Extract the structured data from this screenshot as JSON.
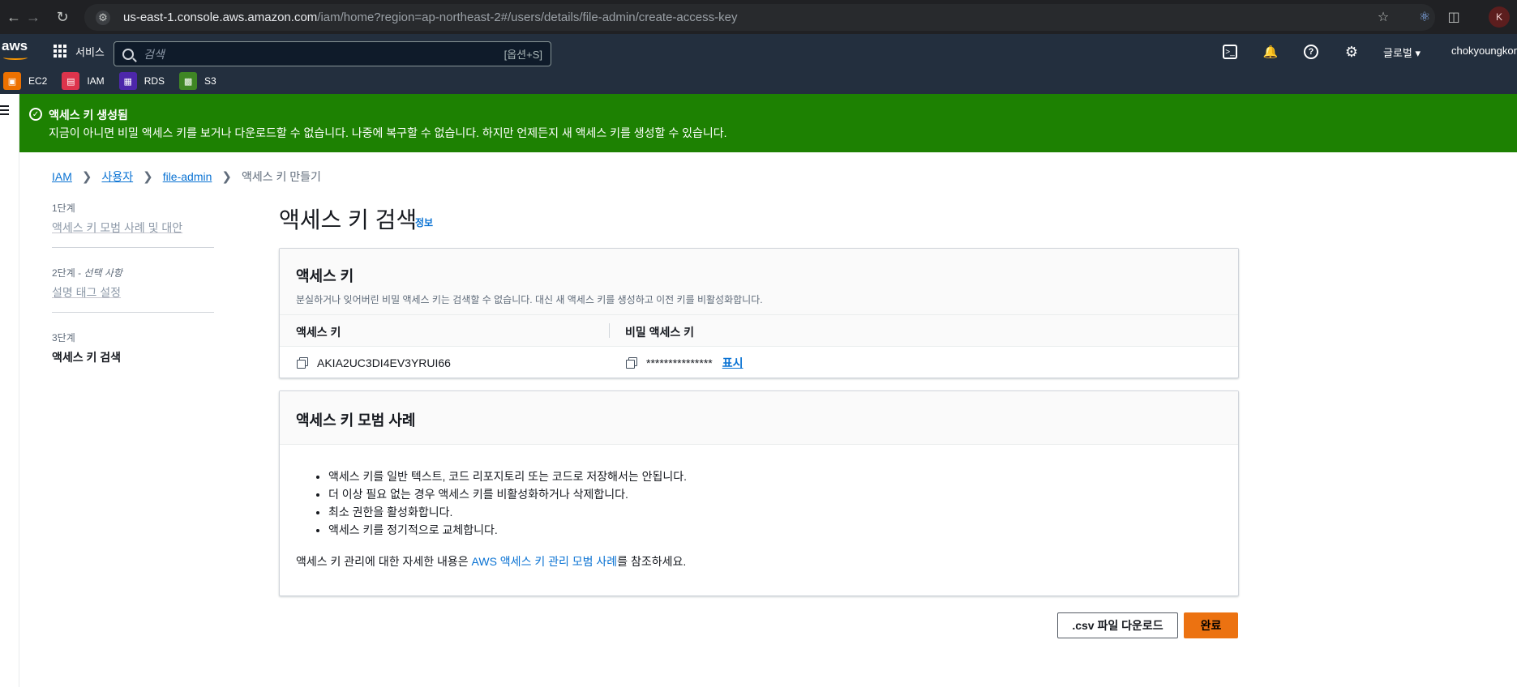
{
  "browser": {
    "url_host": "us-east-1.console.aws.amazon.com",
    "url_path": "/iam/home?region=ap-northeast-2#/users/details/file-admin/create-access-key",
    "profile_initial": "K"
  },
  "topnav": {
    "logo": "aws",
    "services_label": "서비스",
    "search_placeholder": "검색",
    "search_hint": "[옵션+S]",
    "region_label": "글로벌 ▾",
    "user_label": "chokyoungkon"
  },
  "favorites": [
    {
      "label": "EC2",
      "color": "#ed7100"
    },
    {
      "label": "IAM",
      "color": "#dd344c"
    },
    {
      "label": "RDS",
      "color": "#4d27aa"
    },
    {
      "label": "S3",
      "color": "#3f8624"
    }
  ],
  "flash": {
    "title": "액세스 키 생성됨",
    "message": "지금이 아니면 비밀 액세스 키를 보거나 다운로드할 수 없습니다. 나중에 복구할 수 없습니다. 하지만 언제든지 새 액세스 키를 생성할 수 있습니다.",
    "color": "#1d8102"
  },
  "breadcrumb": {
    "items": [
      "IAM",
      "사용자",
      "file-admin"
    ],
    "current": "액세스 키 만들기"
  },
  "steps": [
    {
      "label": "1단계",
      "label_suffix": "",
      "name": "액세스 키 모범 사례 및 대안"
    },
    {
      "label": "2단계 - ",
      "label_suffix": "선택 사항",
      "name": "설명 태그 설정"
    },
    {
      "label": "3단계",
      "label_suffix": "",
      "name": "액세스 키 검색"
    }
  ],
  "page": {
    "title": "액세스 키 검색",
    "info_link": "정보"
  },
  "access_key_panel": {
    "title": "액세스 키",
    "description": "분실하거나 잊어버린 비밀 액세스 키는 검색할 수 없습니다. 대신 새 액세스 키를 생성하고 이전 키를 비활성화합니다.",
    "col_access_key": "액세스 키",
    "col_secret_key": "비밀 액세스 키",
    "access_key_value": "AKIA2UC3DI4EV3YRUI66",
    "secret_key_masked": "***************",
    "show_label": "표시"
  },
  "best_practices_panel": {
    "title": "액세스 키 모범 사례",
    "items": [
      "액세스 키를 일반 텍스트, 코드 리포지토리 또는 코드로 저장해서는 안됩니다.",
      "더 이상 필요 없는 경우 액세스 키를 비활성화하거나 삭제합니다.",
      "최소 권한을 활성화합니다.",
      "액세스 키를 정기적으로 교체합니다."
    ],
    "more_prefix": "액세스 키 관리에 대한 자세한 내용은 ",
    "more_link": "AWS 액세스 키 관리 모범 사례",
    "more_suffix": "를 참조하세요."
  },
  "actions": {
    "download_csv": ".csv 파일 다운로드",
    "done": "완료"
  }
}
